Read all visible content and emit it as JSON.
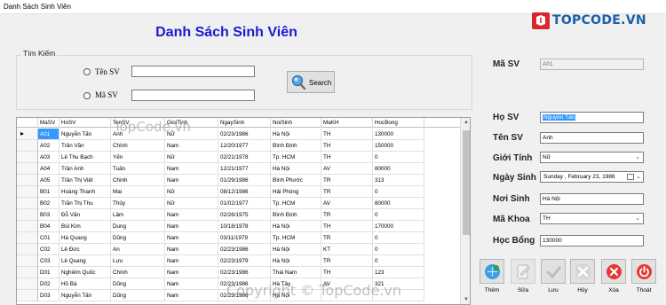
{
  "window": {
    "title": "Danh Sách Sinh Viên"
  },
  "logo": {
    "text": "TOPCODE.VN"
  },
  "main": {
    "title": "Danh Sách Sinh Viên"
  },
  "search": {
    "group_label": "Tìm Kiếm",
    "option_ten_sv": "Tên SV",
    "option_ma_sv": "Mã SV",
    "ten_sv_value": "",
    "ma_sv_value": "",
    "button_label": "Search"
  },
  "grid": {
    "columns": [
      "MaSV",
      "HoSV",
      "TenSV",
      "GioiTinh",
      "NgaySinh",
      "NoiSinh",
      "MaKH",
      "HocBong"
    ],
    "rows": [
      [
        "A01",
        "Nguyễn Tấn",
        "Anh",
        "Nữ",
        "02/23/1986",
        "Hà Nội",
        "TH",
        "130000"
      ],
      [
        "A02",
        "Trần Văn",
        "Chính",
        "Nam",
        "12/20/1977",
        "Bình Định",
        "TH",
        "150000"
      ],
      [
        "A03",
        "Lê Thu Bạch",
        "Yến",
        "Nữ",
        "02/21/1978",
        "Tp. HCM",
        "TH",
        "0"
      ],
      [
        "A04",
        "Trần Anh",
        "Tuấn",
        "Nam",
        "12/21/1977",
        "Hà Nội",
        "AV",
        "80000"
      ],
      [
        "A05",
        "Trần Thị Việt",
        "Chinh",
        "Nam",
        "01/29/1986",
        "Bình Phước",
        "TR",
        "313"
      ],
      [
        "B01",
        "Hoàng Thanh",
        "Mai",
        "Nữ",
        "08/12/1986",
        "Hải Phòng",
        "TR",
        "0"
      ],
      [
        "B02",
        "Trần Thị Thu",
        "Thủy",
        "Nữ",
        "01/02/1977",
        "Tp. HCM",
        "AV",
        "80000"
      ],
      [
        "B03",
        "Đỗ Văn",
        "Lâm",
        "Nam",
        "02/26/1975",
        "Bình Định",
        "TR",
        "0"
      ],
      [
        "B04",
        "Bùi Kim",
        "Dung",
        "Nam",
        "10/18/1978",
        "Hà Nội",
        "TH",
        "170000"
      ],
      [
        "C01",
        "Hà Quang",
        "Dũng",
        "Nam",
        "03/11/1979",
        "Tp. HCM",
        "TR",
        "0"
      ],
      [
        "C02",
        "Lê Đức",
        "An",
        "Nam",
        "02/23/1986",
        "Hà Nội",
        "KT",
        "0"
      ],
      [
        "C03",
        "Lê Quang",
        "Lưu",
        "Nam",
        "02/23/1979",
        "Hà Nội",
        "TR",
        "0"
      ],
      [
        "D01",
        "Nghiêm Quốc",
        "Chính",
        "Nam",
        "02/23/1986",
        "Thái Nam",
        "TH",
        "123"
      ],
      [
        "D02",
        "Hồ Bá",
        "Dũng",
        "Nam",
        "02/23/1986",
        "Hà Tây",
        "AV",
        "321"
      ],
      [
        "D03",
        "Nguyễn Tấn",
        "Dũng",
        "Nam",
        "02/23/1986",
        "Hà Nội",
        "",
        ""
      ]
    ]
  },
  "form": {
    "ma_sv_label": "Mã SV",
    "ma_sv_value": "A01",
    "ho_sv_label": "Họ SV",
    "ho_sv_value": "Nguyễn Tấn",
    "ten_sv_label": "Tên SV",
    "ten_sv_value": "Anh",
    "gioi_tinh_label": "Giới Tính",
    "gioi_tinh_value": "Nữ",
    "ngay_sinh_label": "Ngày Sinh",
    "ngay_sinh_value": "Sunday  ,  February  23, 1986",
    "noi_sinh_label": "Nơi Sinh",
    "noi_sinh_value": "Hà Nội",
    "ma_khoa_label": "Mã Khoa",
    "ma_khoa_value": "TH",
    "hoc_bong_label": "Học Bổng",
    "hoc_bong_value": "130000"
  },
  "actions": {
    "them": "Thêm",
    "sua": "Sửa",
    "luu": "Lưu",
    "huy": "Hủy",
    "xoa": "Xóa",
    "thoat": "Thoát"
  },
  "watermark": {
    "grid_center": "TopCode.vn",
    "bottom": "Copyright © TopCode.vn"
  },
  "colors": {
    "title_blue": "#1a1ad2",
    "selection": "#3399ff",
    "logo_blue": "#1a5fa8",
    "logo_red": "#d9262e"
  }
}
